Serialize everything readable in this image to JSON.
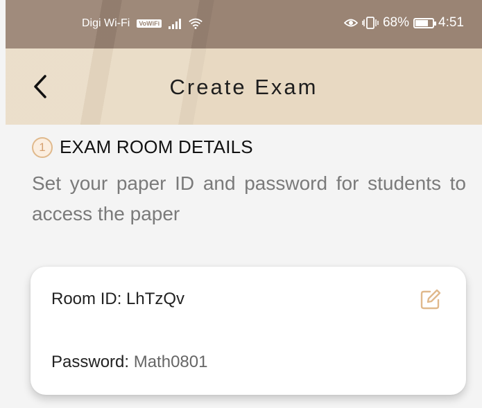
{
  "status_bar": {
    "carrier": "Digi Wi-Fi",
    "volte_badge": "VoWiFi",
    "battery": "68%",
    "battery_level": 0.68,
    "time": "4:51"
  },
  "app_bar": {
    "title": "Create Exam"
  },
  "section": {
    "step": "1",
    "title": "EXAM ROOM DETAILS",
    "description": "Set your paper ID and password for students to access the paper"
  },
  "room_card": {
    "room_label": "Room ID: ",
    "room_value": "LhTzQv",
    "password_label": "Password: ",
    "password_value": "Math0801"
  },
  "colors": {
    "accent": "#e0b98c",
    "app_bar": "#e8d9c2",
    "status_bar": "#9a8474"
  },
  "icons": {
    "back": "chevron-left-icon",
    "edit": "edit-icon"
  }
}
